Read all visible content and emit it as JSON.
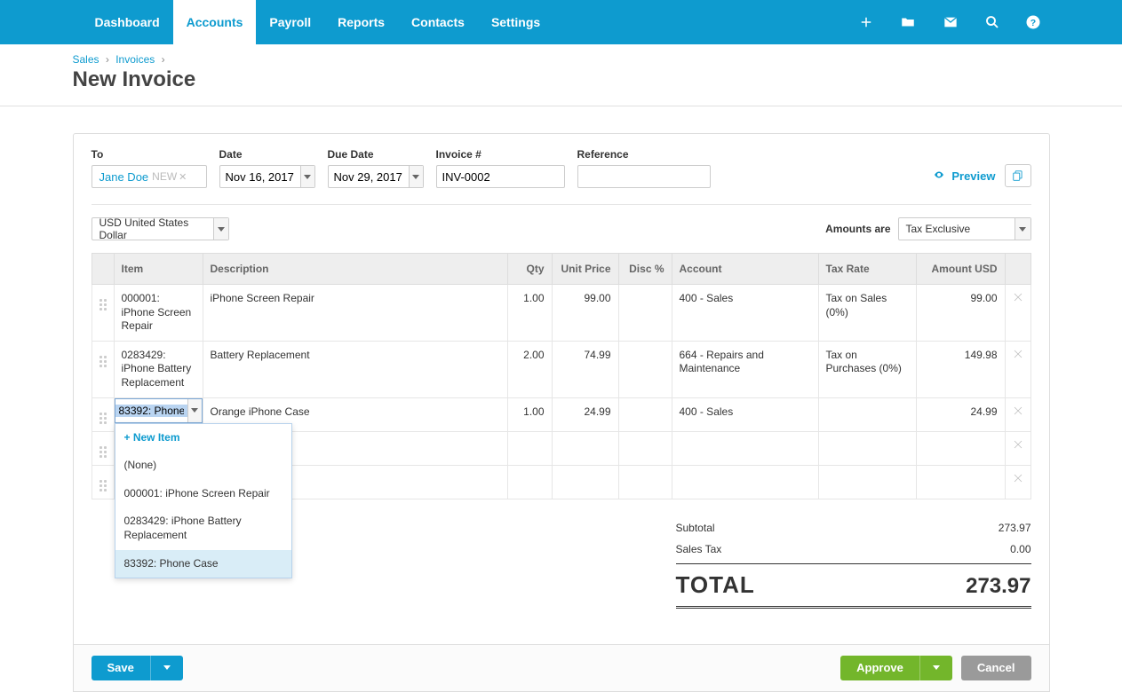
{
  "nav": {
    "items": [
      "Dashboard",
      "Accounts",
      "Payroll",
      "Reports",
      "Contacts",
      "Settings"
    ],
    "active_index": 1
  },
  "breadcrumb": {
    "level1": "Sales",
    "level2": "Invoices",
    "title": "New Invoice"
  },
  "header": {
    "to_label": "To",
    "to_value": "Jane Doe",
    "to_new": "NEW",
    "date_label": "Date",
    "date_value": "Nov 16, 2017",
    "due_label": "Due Date",
    "due_value": "Nov 29, 2017",
    "invno_label": "Invoice #",
    "invno_value": "INV-0002",
    "ref_label": "Reference",
    "ref_value": "",
    "preview_label": "Preview"
  },
  "row2": {
    "currency": "USD United States Dollar",
    "amounts_are_label": "Amounts are",
    "amounts_are_value": "Tax Exclusive"
  },
  "columns": {
    "item": "Item",
    "desc": "Description",
    "qty": "Qty",
    "unitprice": "Unit Price",
    "disc": "Disc %",
    "account": "Account",
    "tax": "Tax Rate",
    "amount": "Amount USD"
  },
  "lines": [
    {
      "item": "000001: iPhone Screen Repair",
      "desc": "iPhone Screen Repair",
      "qty": "1.00",
      "price": "99.00",
      "disc": "",
      "account": "400 - Sales",
      "tax": "Tax on Sales (0%)",
      "amount": "99.00"
    },
    {
      "item": "0283429: iPhone Battery Replacement",
      "desc": "Battery Replacement",
      "qty": "2.00",
      "price": "74.99",
      "disc": "",
      "account": "664 - Repairs and Maintenance",
      "tax": "Tax on Purchases (0%)",
      "amount": "149.98"
    },
    {
      "item": "83392: Phone",
      "desc": "Orange iPhone Case",
      "qty": "1.00",
      "price": "24.99",
      "disc": "",
      "account": "400 - Sales",
      "tax": "",
      "amount": "24.99",
      "editing": true
    }
  ],
  "empty_rows": 2,
  "item_dropdown": {
    "new_item": "+ New Item",
    "options": [
      {
        "label": "(None)"
      },
      {
        "label": "000001: iPhone Screen Repair"
      },
      {
        "label": "0283429: iPhone Battery Replacement"
      },
      {
        "label": "83392: Phone Case",
        "highlight": true
      }
    ]
  },
  "totals": {
    "subtotal_label": "Subtotal",
    "subtotal": "273.97",
    "salestax_label": "Sales Tax",
    "salestax": "0.00",
    "total_label": "TOTAL",
    "total": "273.97"
  },
  "footer": {
    "save": "Save",
    "approve": "Approve",
    "cancel": "Cancel"
  }
}
